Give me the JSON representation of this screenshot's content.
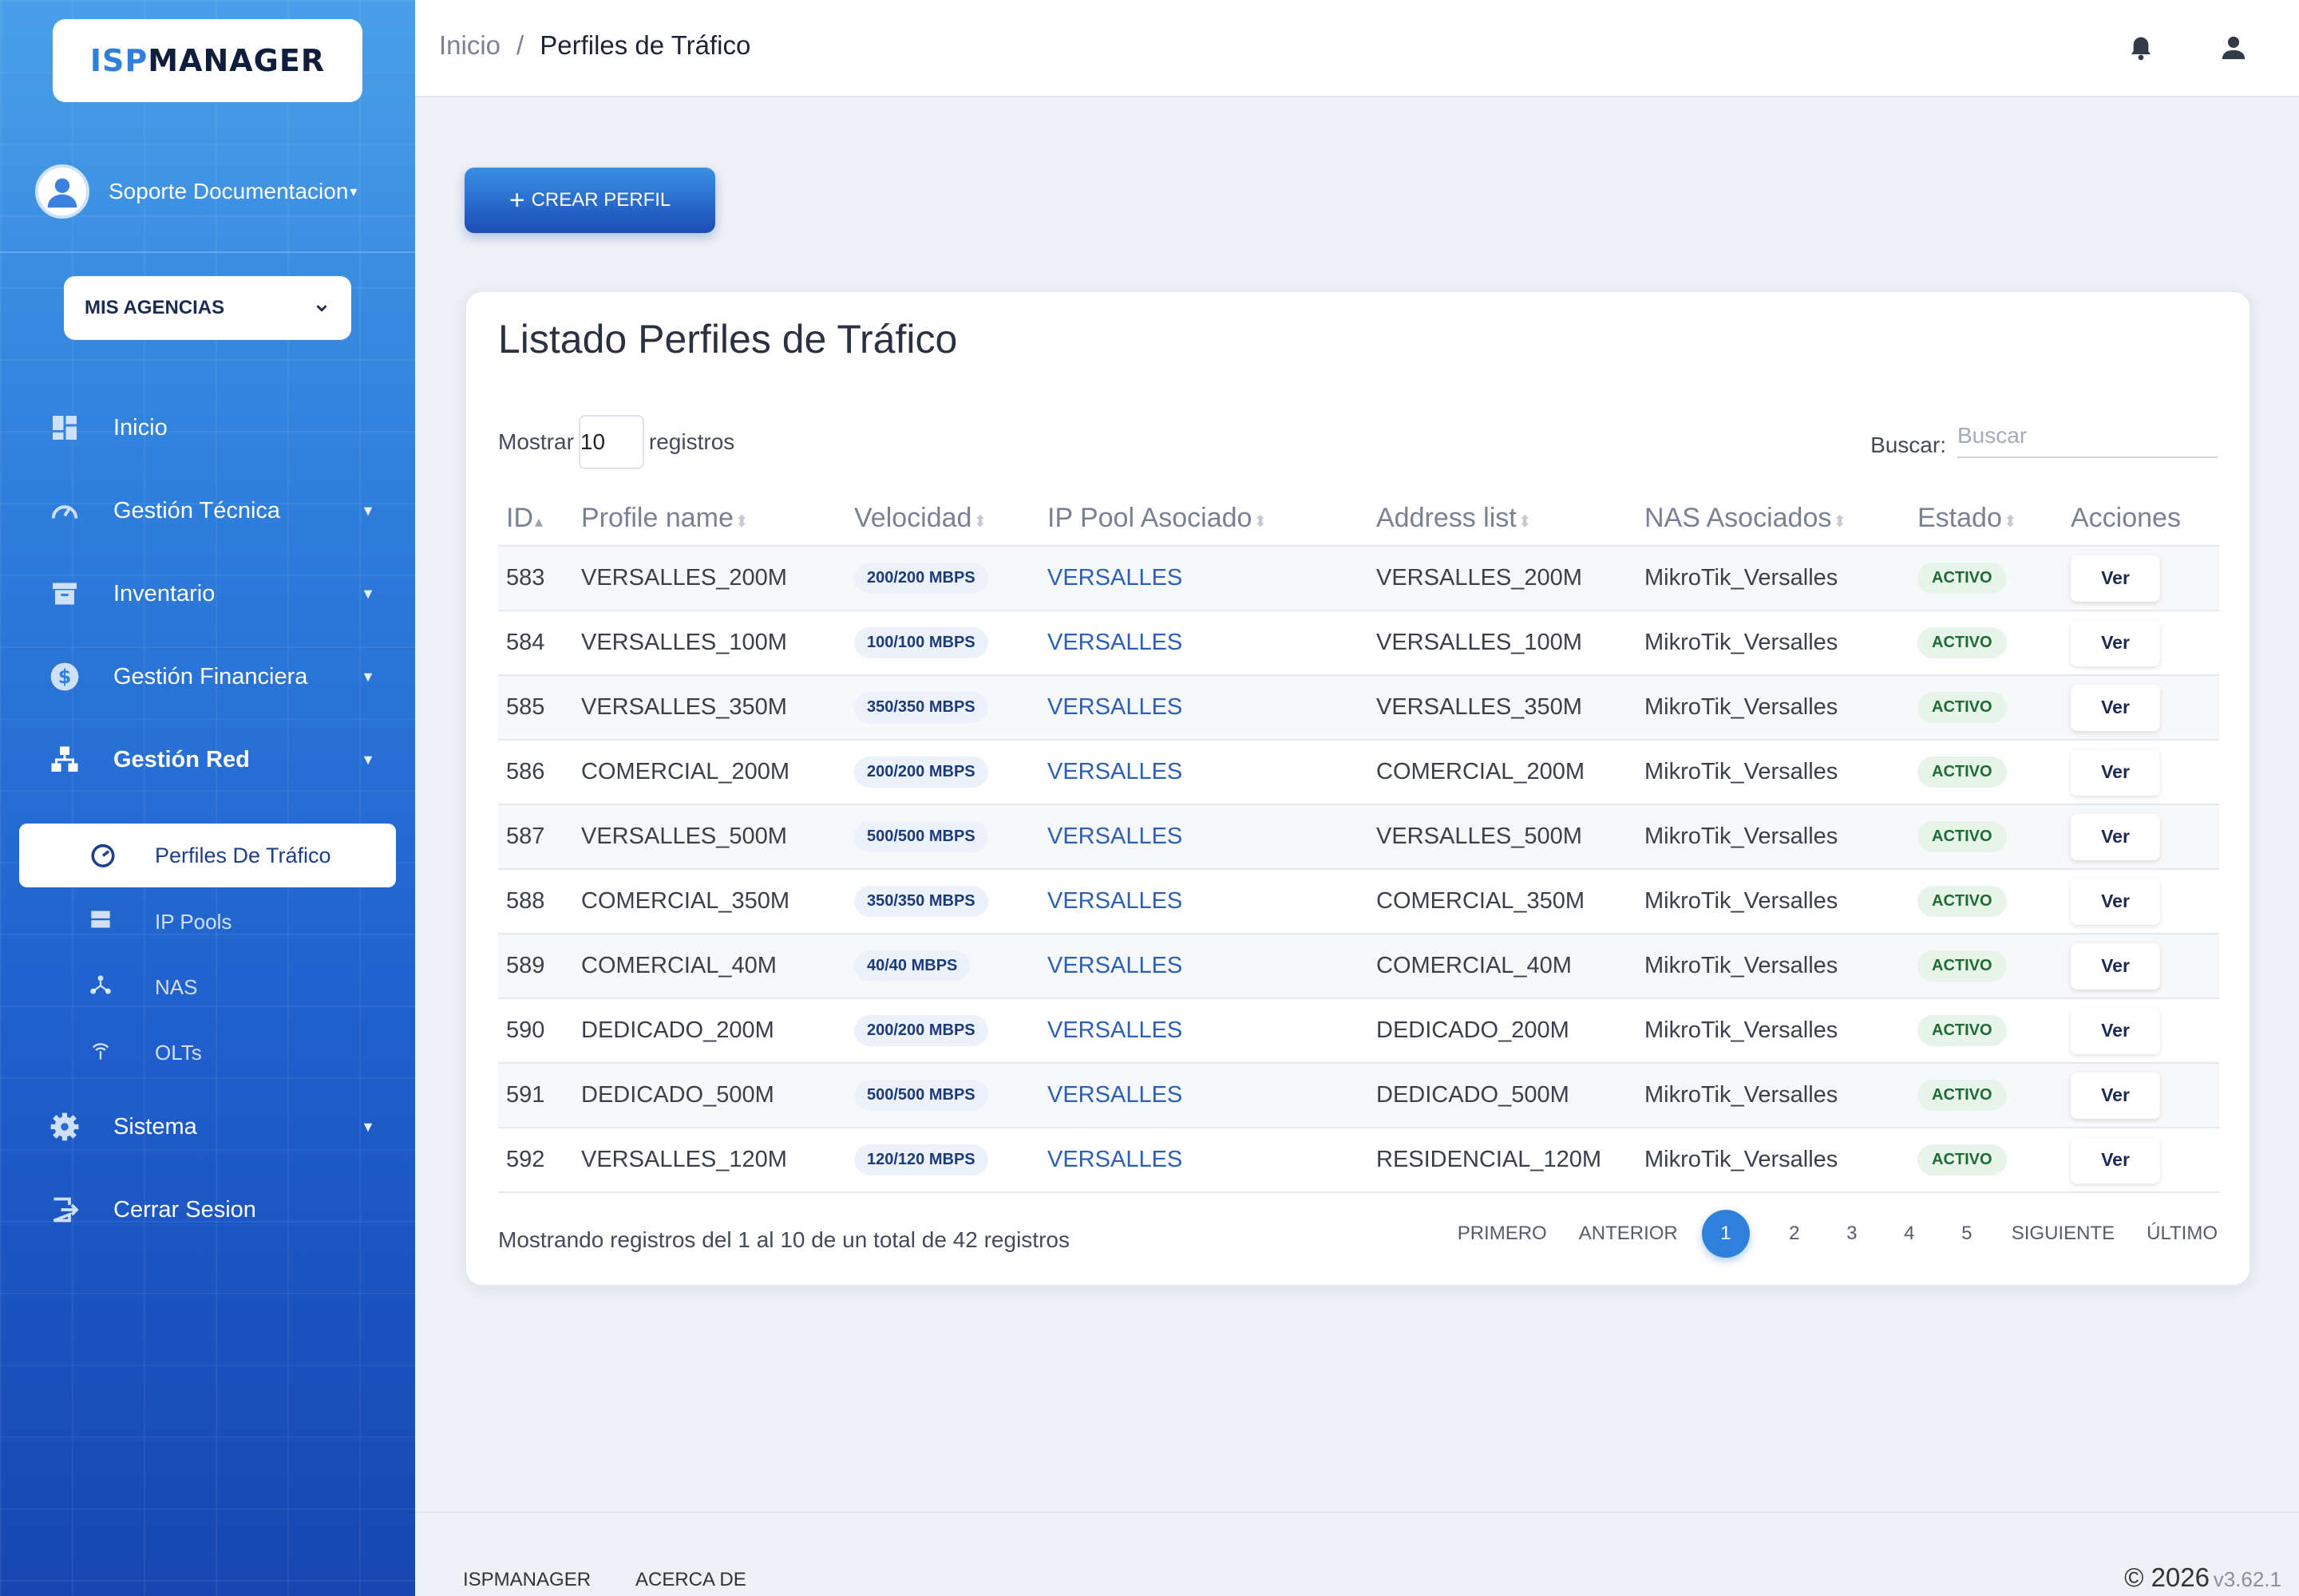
{
  "app": {
    "logo_part1": "ISP",
    "logo_part2": "MANAGER"
  },
  "user": {
    "name": "Soporte Documentacion"
  },
  "agency": {
    "label": "MIS AGENCIAS"
  },
  "sidebar": {
    "items": [
      {
        "label": "Inicio",
        "icon": "dashboard-icon"
      },
      {
        "label": "Gestión Técnica",
        "icon": "speedometer-icon"
      },
      {
        "label": "Inventario",
        "icon": "archive-icon"
      },
      {
        "label": "Gestión Financiera",
        "icon": "dollar-icon"
      },
      {
        "label": "Gestión Red",
        "icon": "network-icon"
      },
      {
        "label": "Sistema",
        "icon": "gear-icon"
      },
      {
        "label": "Cerrar Sesion",
        "icon": "logout-icon"
      }
    ],
    "subitems": [
      {
        "label": "Perfiles De Tráfico",
        "icon": "gauge-icon"
      },
      {
        "label": "IP Pools",
        "icon": "server-icon"
      },
      {
        "label": "NAS",
        "icon": "hub-icon"
      },
      {
        "label": "OLTs",
        "icon": "antenna-icon"
      }
    ]
  },
  "breadcrumb": {
    "home": "Inicio",
    "separator": "/",
    "current": "Perfiles de Tráfico"
  },
  "actions": {
    "create": "CREAR PERFIL"
  },
  "card": {
    "title": "Listado Perfiles de Tráfico",
    "show_label": "Mostrar",
    "show_value": "10",
    "show_suffix": "registros",
    "search_label": "Buscar:",
    "search_placeholder": "Buscar"
  },
  "table": {
    "headers": [
      "ID",
      "Profile name",
      "Velocidad",
      "IP Pool Asociado",
      "Address list",
      "NAS Asociados",
      "Estado",
      "Acciones"
    ],
    "rows": [
      {
        "id": "583",
        "name": "VERSALLES_200M",
        "speed": "200/200 MBPS",
        "pool": "VERSALLES",
        "address": "VERSALLES_200M",
        "nas": "MikroTik_Versalles",
        "estado": "ACTIVO",
        "action": "Ver"
      },
      {
        "id": "584",
        "name": "VERSALLES_100M",
        "speed": "100/100 MBPS",
        "pool": "VERSALLES",
        "address": "VERSALLES_100M",
        "nas": "MikroTik_Versalles",
        "estado": "ACTIVO",
        "action": "Ver"
      },
      {
        "id": "585",
        "name": "VERSALLES_350M",
        "speed": "350/350 MBPS",
        "pool": "VERSALLES",
        "address": "VERSALLES_350M",
        "nas": "MikroTik_Versalles",
        "estado": "ACTIVO",
        "action": "Ver"
      },
      {
        "id": "586",
        "name": "COMERCIAL_200M",
        "speed": "200/200 MBPS",
        "pool": "VERSALLES",
        "address": "COMERCIAL_200M",
        "nas": "MikroTik_Versalles",
        "estado": "ACTIVO",
        "action": "Ver"
      },
      {
        "id": "587",
        "name": "VERSALLES_500M",
        "speed": "500/500 MBPS",
        "pool": "VERSALLES",
        "address": "VERSALLES_500M",
        "nas": "MikroTik_Versalles",
        "estado": "ACTIVO",
        "action": "Ver"
      },
      {
        "id": "588",
        "name": "COMERCIAL_350M",
        "speed": "350/350 MBPS",
        "pool": "VERSALLES",
        "address": "COMERCIAL_350M",
        "nas": "MikroTik_Versalles",
        "estado": "ACTIVO",
        "action": "Ver"
      },
      {
        "id": "589",
        "name": "COMERCIAL_40M",
        "speed": "40/40 MBPS",
        "pool": "VERSALLES",
        "address": "COMERCIAL_40M",
        "nas": "MikroTik_Versalles",
        "estado": "ACTIVO",
        "action": "Ver"
      },
      {
        "id": "590",
        "name": "DEDICADO_200M",
        "speed": "200/200 MBPS",
        "pool": "VERSALLES",
        "address": "DEDICADO_200M",
        "nas": "MikroTik_Versalles",
        "estado": "ACTIVO",
        "action": "Ver"
      },
      {
        "id": "591",
        "name": "DEDICADO_500M",
        "speed": "500/500 MBPS",
        "pool": "VERSALLES",
        "address": "DEDICADO_500M",
        "nas": "MikroTik_Versalles",
        "estado": "ACTIVO",
        "action": "Ver"
      },
      {
        "id": "592",
        "name": "VERSALLES_120M",
        "speed": "120/120 MBPS",
        "pool": "VERSALLES",
        "address": "RESIDENCIAL_120M",
        "nas": "MikroTik_Versalles",
        "estado": "ACTIVO",
        "action": "Ver"
      }
    ]
  },
  "pagination": {
    "info": "Mostrando registros del 1 al 10 de un total de 42 registros",
    "first": "PRIMERO",
    "prev": "ANTERIOR",
    "pages": [
      "1",
      "2",
      "3",
      "4",
      "5"
    ],
    "current": "1",
    "next": "SIGUIENTE",
    "last": "ÚLTIMO"
  },
  "footer": {
    "link1": "ISPMANAGER",
    "link2": "ACERCA DE",
    "copyright": "© 2026",
    "version": "v3.62.1"
  },
  "colors": {
    "primary": "#2f7fdc",
    "sidebar_dark": "#1746b0",
    "link": "#2b5fb8",
    "active_badge_bg": "#e6f4ea"
  }
}
